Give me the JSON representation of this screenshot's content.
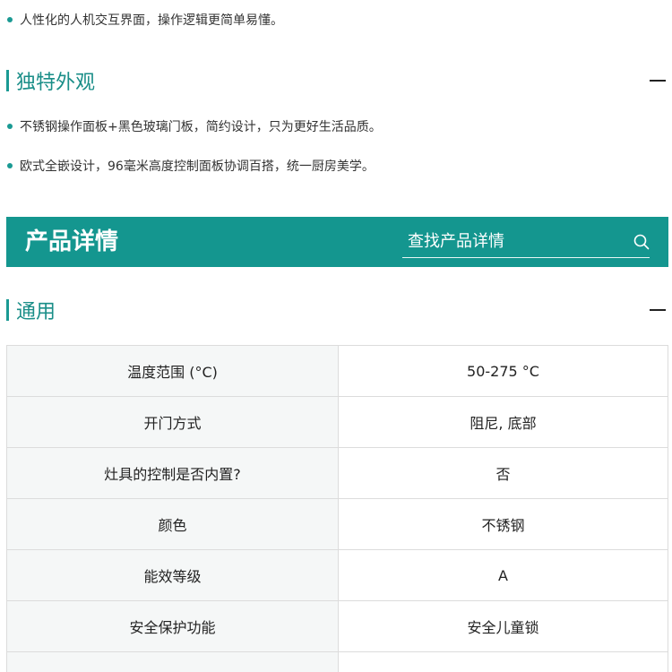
{
  "intro": {
    "bullets": [
      "人性化的人机交互界面，操作逻辑更简单易懂。"
    ]
  },
  "section_appearance": {
    "title": "独特外观",
    "bullets": [
      "不锈钢操作面板+黑色玻璃门板，简约设计，只为更好生活品质。",
      "欧式全嵌设计，96毫米高度控制面板协调百搭，统一厨房美学。"
    ]
  },
  "banner": {
    "title": "产品详情",
    "search_placeholder": "查找产品详情",
    "icon": "search-icon"
  },
  "section_general": {
    "title": "通用",
    "rows": [
      {
        "key": "温度范围 (°C)",
        "value": "50-275 °C"
      },
      {
        "key": "开门方式",
        "value": "阻尼, 底部"
      },
      {
        "key": "灶具的控制是否内置?",
        "value": "否"
      },
      {
        "key": "颜色",
        "value": "不锈钢"
      },
      {
        "key": "能效等级",
        "value": "A"
      },
      {
        "key": "安全保护功能",
        "value": "安全儿童锁"
      },
      {
        "key": "",
        "value": ""
      }
    ]
  },
  "colors": {
    "accent": "#14968f",
    "table_key_bg": "#f5f7f7"
  }
}
